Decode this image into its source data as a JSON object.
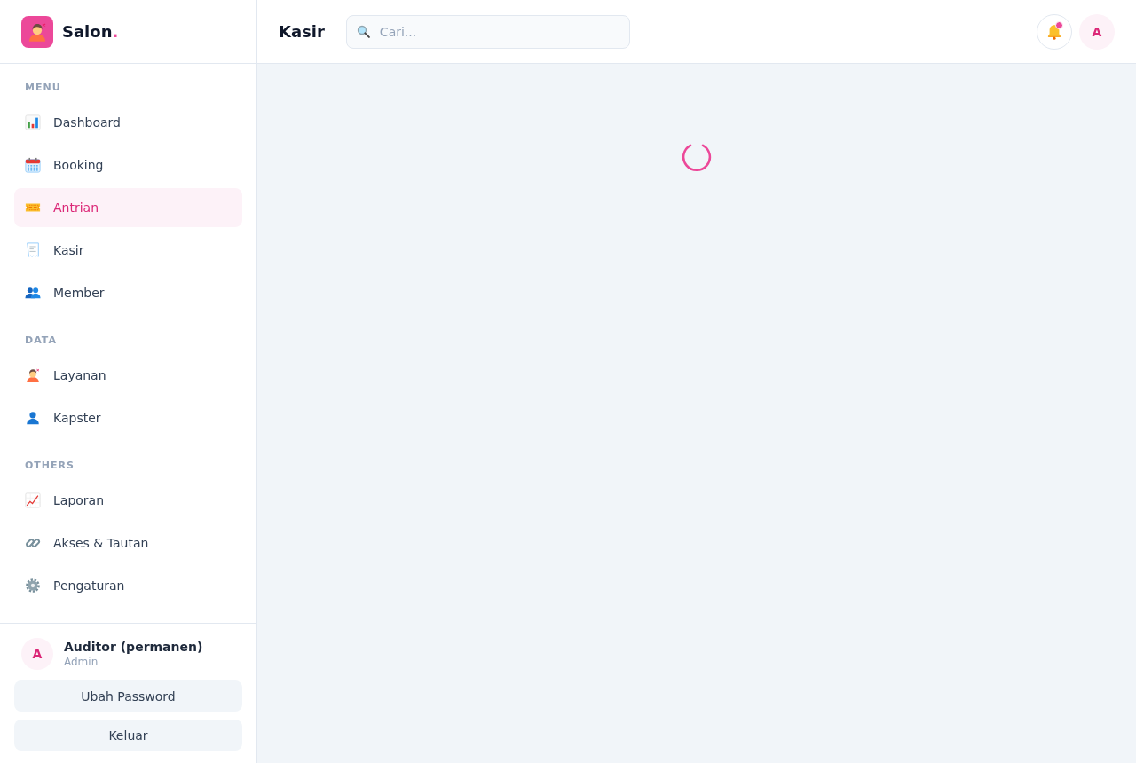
{
  "sidebar": {
    "brand": {
      "name": "Salon",
      "accent": "."
    },
    "sections": [
      {
        "title": "MENU",
        "items": [
          {
            "label": "Dashboard",
            "selected": false
          },
          {
            "label": "Booking",
            "selected": false
          },
          {
            "label": "Antrian",
            "selected": true
          },
          {
            "label": "Kasir",
            "selected": false
          },
          {
            "label": "Member",
            "selected": false
          }
        ]
      },
      {
        "title": "DATA",
        "items": [
          {
            "label": "Layanan",
            "selected": false
          },
          {
            "label": "Kapster",
            "selected": false
          }
        ]
      },
      {
        "title": "OTHERS",
        "items": [
          {
            "label": "Laporan",
            "selected": false
          },
          {
            "label": "Akses & Tautan",
            "selected": false
          },
          {
            "label": "Pengaturan",
            "selected": false
          }
        ]
      }
    ],
    "user": {
      "initial": "A",
      "name": "Auditor (permanen)",
      "role": "Admin"
    },
    "buttons": [
      "Ubah Password",
      "Keluar"
    ]
  },
  "header": {
    "title": "Kasir",
    "search": {
      "placeholder": "Cari..."
    },
    "notifications": {
      "unread": true
    },
    "avatar": "A"
  }
}
